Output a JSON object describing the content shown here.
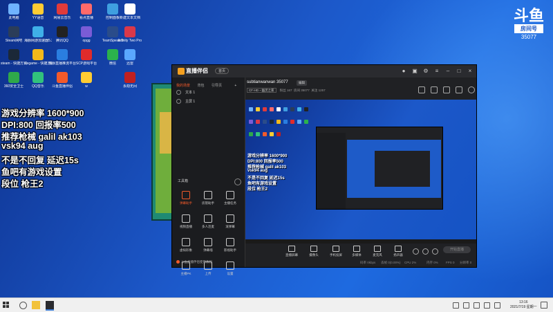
{
  "desktop": {
    "icons": [
      {
        "label": "此电脑",
        "color": "#6fb3ff"
      },
      {
        "label": "YY语音",
        "color": "#ffcc33"
      },
      {
        "label": "网易云音乐",
        "color": "#e03b3b"
      },
      {
        "label": "看点直播",
        "color": "#ff6a6a"
      },
      {
        "label": "新建文本文档",
        "color": "#ffffff"
      },
      {
        "label": "控制面板",
        "color": "#3f9fe0"
      },
      {
        "label": "Steam网吧",
        "color": "#2b3d59"
      },
      {
        "label": "海豚网游加速器5.2",
        "color": "#3fb0e8"
      },
      {
        "label": "腾讯QQ",
        "color": "#222222"
      },
      {
        "label": "opgg",
        "color": "#7a5cd6"
      },
      {
        "label": "Infinity Two Pro",
        "color": "#d9384a"
      },
      {
        "label": "TeamSpeak 3",
        "color": "#2a4c8a"
      },
      {
        "label": "steam - 快捷方式",
        "color": "#1b2838"
      },
      {
        "label": "wegame - 快捷方式",
        "color": "#f2b91b"
      },
      {
        "label": "海豚直播推流平台",
        "color": "#2a7ee0"
      },
      {
        "label": "SCP游戏平台",
        "color": "#e02b2b"
      },
      {
        "label": "迅雷",
        "color": "#5aa7ff"
      },
      {
        "label": "微信",
        "color": "#2bb24c"
      },
      {
        "label": "360安全卫士",
        "color": "#2fa84a"
      },
      {
        "label": "QQ音乐",
        "color": "#31c27c"
      },
      {
        "label": "斗鱼直播伴侣",
        "color": "#f25a2b"
      },
      {
        "label": "w",
        "color": "#ffcc33"
      },
      {
        "label": "永劫无间",
        "color": "#c02020"
      }
    ]
  },
  "overlay": {
    "lines": [
      "游戏分辨率 1600*900",
      "DPI:800 回报率500",
      "推荐枪械 galil ak103",
      "vsk94 aug",
      "不是不回复 延迟15s",
      "鱼吧有游戏设置",
      "段位 枪王2"
    ]
  },
  "logo": {
    "glyph": "斗鱼",
    "sub": "房间号",
    "room": "35077"
  },
  "app": {
    "name": "直播伴侣",
    "home_label": "首页",
    "left_tabs": [
      "我的场景",
      "背包",
      "引导页"
    ],
    "scenes": [
      "文本 1",
      "主屏 1"
    ],
    "tools_header": "工具箱",
    "tools": [
      {
        "label": "弹幕助手",
        "icon": "danmu-icon",
        "active": true
      },
      {
        "label": "房管助手",
        "icon": "admin-icon",
        "active": false
      },
      {
        "label": "主播任务",
        "icon": "task-icon",
        "active": false
      },
      {
        "label": "视频直播",
        "icon": "video-icon",
        "active": false
      },
      {
        "label": "多人连麦",
        "icon": "link-icon",
        "active": false
      },
      {
        "label": "滚弹幕",
        "icon": "scroll-icon",
        "active": false
      },
      {
        "label": "虚拟形象",
        "icon": "avatar-icon",
        "active": false
      },
      {
        "label": "弹幕墙",
        "icon": "wall-icon",
        "active": false
      },
      {
        "label": "影视助手",
        "icon": "movie-icon",
        "active": false
      },
      {
        "label": "主播PK",
        "icon": "pk-icon",
        "active": false
      },
      {
        "label": "上传",
        "icon": "upload-icon",
        "active": false
      },
      {
        "label": "设置",
        "icon": "settings-icon",
        "active": false
      }
    ],
    "left_footer": "斗鱼直播伴侣使用教程",
    "room_title": "subtianwanwan 35077",
    "edit_label": "编辑",
    "category": "CF-HD・幽灵之家",
    "meta": [
      "粉丝 167",
      "房间 35077",
      "关注 1257"
    ],
    "bottom_buttons": [
      "直播屏幕",
      "摄像头",
      "手机投屏",
      "多媒体",
      "麦克风",
      "扬声器"
    ],
    "start_live": "开始直播",
    "status": [
      "码率 0kbps",
      "丢帧 0(0.00%)",
      "CPU 2%",
      "内存 0%",
      "FPS 0",
      "分辨率 0"
    ]
  },
  "taskbar": {
    "time": "13:16",
    "date": "2021/7/19 星期一"
  }
}
